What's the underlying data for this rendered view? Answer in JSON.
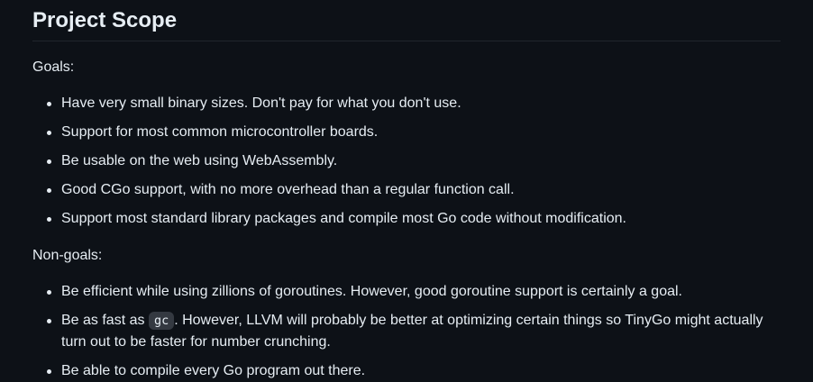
{
  "section": {
    "title": "Project Scope"
  },
  "goals": {
    "label": "Goals:",
    "items": [
      "Have very small binary sizes. Don't pay for what you don't use.",
      "Support for most common microcontroller boards.",
      "Be usable on the web using WebAssembly.",
      "Good CGo support, with no more overhead than a regular function call.",
      "Support most standard library packages and compile most Go code without modification."
    ]
  },
  "nongoals": {
    "label": "Non-goals:",
    "item1": "Be efficient while using zillions of goroutines. However, good goroutine support is certainly a goal.",
    "item2_prefix": "Be as fast as ",
    "item2_code": "gc",
    "item2_suffix": ". However, LLVM will probably be better at optimizing certain things so TinyGo might actually turn out to be faster for number crunching.",
    "item3": "Be able to compile every Go program out there."
  }
}
